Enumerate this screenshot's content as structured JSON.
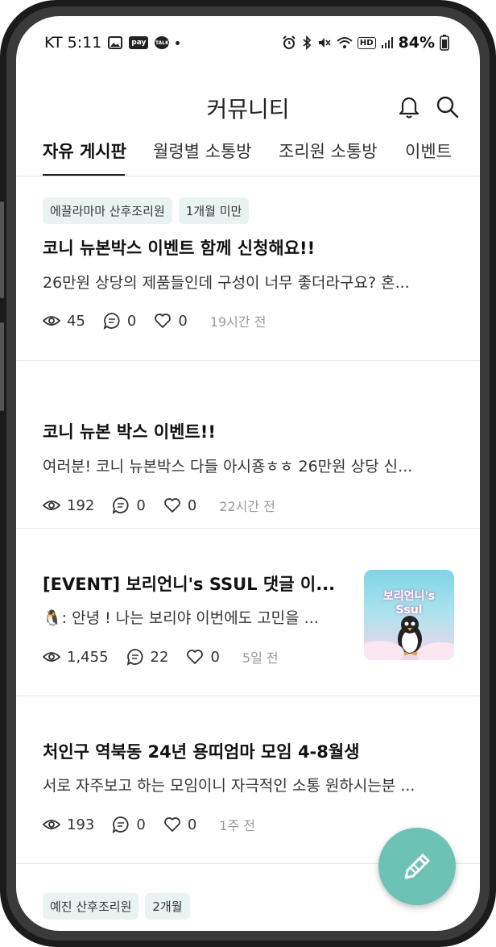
{
  "status_bar": {
    "carrier_time": "KT 5:11",
    "pay_badge": "pay",
    "talk_badge": "TALK",
    "battery": "84%",
    "hd_badge": "HD",
    "icons": [
      "image-icon",
      "pay-icon",
      "talk-icon",
      "dot-icon",
      "alarm-icon",
      "bluetooth-icon",
      "mute-icon",
      "wifi-icon",
      "hd-icon",
      "signal-icon",
      "battery-icon"
    ]
  },
  "header": {
    "title": "커뮤니티",
    "icons": [
      "bell-icon",
      "search-icon"
    ]
  },
  "tabs": [
    {
      "label": "자유 게시판",
      "active": true
    },
    {
      "label": "월령별 소통방",
      "active": false
    },
    {
      "label": "조리원 소통방",
      "active": false
    },
    {
      "label": "이벤트",
      "active": false
    }
  ],
  "posts": [
    {
      "tags": [
        "에끌라마마 산후조리원",
        "1개월 미만"
      ],
      "title": "코니 뉴본박스 이벤트 함께 신청해요!!",
      "body": "26만원 상당의 제품들인데 구성이 너무 좋더라구요? 혼...",
      "views": "45",
      "comments": "0",
      "likes": "0",
      "time": "19시간 전"
    },
    {
      "tags": [],
      "title": "코니 뉴본 박스 이벤트!!",
      "body": "여러분! 코니 뉴본박스 다들 아시죵ㅎㅎ 26만원 상당 신...",
      "views": "192",
      "comments": "0",
      "likes": "0",
      "time": "22시간 전"
    },
    {
      "tags": [],
      "title": "[EVENT] 보리언니's SSUL 댓글 이...",
      "body": "🐧: 안녕 ! 나는 보리야 이번에도 고민을 ...",
      "views": "1,455",
      "comments": "22",
      "likes": "0",
      "time": "5일 전",
      "thumbnail": {
        "title": "보리언니's Ssul"
      }
    },
    {
      "tags": [],
      "title": "처인구 역북동 24년 용띠엄마 모임 4-8월생",
      "body": "서로 자주보고 하는 모임이니 자극적인 소통 원하시는분 ...",
      "views": "193",
      "comments": "0",
      "likes": "0",
      "time": "1주 전"
    },
    {
      "tags": [
        "예진 산후조리원",
        "2개월"
      ]
    }
  ],
  "fab": {
    "icon": "pencil-icon"
  },
  "colors": {
    "accent": "#6cc2b5",
    "tag_bg": "#e9f4f2"
  }
}
